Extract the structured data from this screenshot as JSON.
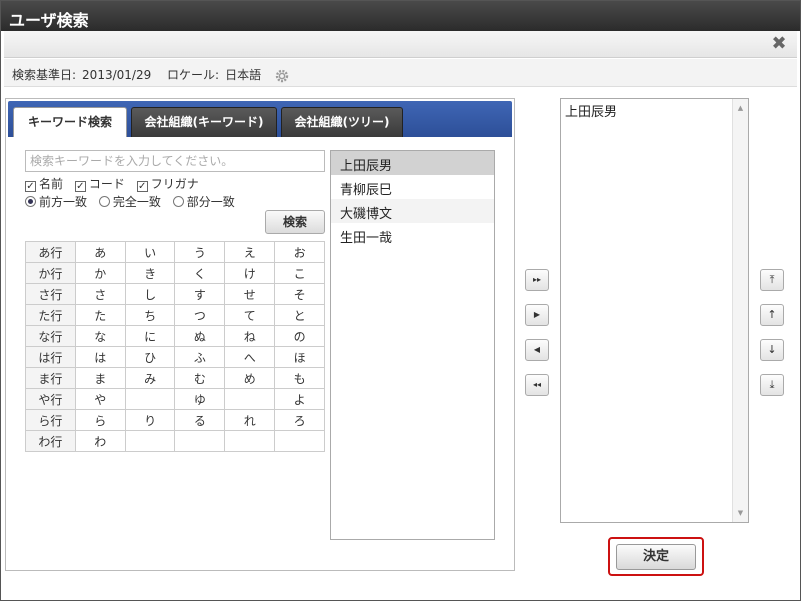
{
  "window": {
    "title": "ユーザ検索"
  },
  "toolbar": {
    "close_icon": "close-icon"
  },
  "info": {
    "base_date_label": "検索基準日:",
    "base_date_value": "2013/01/29",
    "locale_label": "ロケール:",
    "locale_value": "日本語",
    "settings_icon": "gear-icon"
  },
  "tabs": [
    {
      "label": "キーワード検索",
      "active": true
    },
    {
      "label": "会社組織(キーワード)",
      "active": false
    },
    {
      "label": "会社組織(ツリー)",
      "active": false
    }
  ],
  "search": {
    "placeholder": "検索キーワードを入力してください。",
    "value": "",
    "targets": [
      {
        "label": "名前",
        "checked": true
      },
      {
        "label": "コード",
        "checked": true
      },
      {
        "label": "フリガナ",
        "checked": true
      }
    ],
    "match_modes": [
      {
        "label": "前方一致",
        "selected": true
      },
      {
        "label": "完全一致",
        "selected": false
      },
      {
        "label": "部分一致",
        "selected": false
      }
    ],
    "search_button": "検索"
  },
  "kana_rows": [
    [
      "あ行",
      "あ",
      "い",
      "う",
      "え",
      "お"
    ],
    [
      "か行",
      "か",
      "き",
      "く",
      "け",
      "こ"
    ],
    [
      "さ行",
      "さ",
      "し",
      "す",
      "せ",
      "そ"
    ],
    [
      "た行",
      "た",
      "ち",
      "つ",
      "て",
      "と"
    ],
    [
      "な行",
      "な",
      "に",
      "ぬ",
      "ね",
      "の"
    ],
    [
      "は行",
      "は",
      "ひ",
      "ふ",
      "へ",
      "ほ"
    ],
    [
      "ま行",
      "ま",
      "み",
      "む",
      "め",
      "も"
    ],
    [
      "や行",
      "や",
      "",
      "ゆ",
      "",
      "よ"
    ],
    [
      "ら行",
      "ら",
      "り",
      "る",
      "れ",
      "ろ"
    ],
    [
      "わ行",
      "わ",
      "",
      "",
      "",
      ""
    ]
  ],
  "results": [
    {
      "name": "上田辰男",
      "selected": true
    },
    {
      "name": "青柳辰巳",
      "selected": false
    },
    {
      "name": "大磯博文",
      "selected": false
    },
    {
      "name": "生田一哉",
      "selected": false
    }
  ],
  "move_buttons": [
    {
      "glyph": "▸▸",
      "icon": "add-all-icon"
    },
    {
      "glyph": "▶",
      "icon": "add-icon"
    },
    {
      "glyph": "◀",
      "icon": "remove-icon"
    },
    {
      "glyph": "◂◂",
      "icon": "remove-all-icon"
    }
  ],
  "order_buttons": [
    {
      "glyph": "⤒",
      "icon": "move-top-icon"
    },
    {
      "glyph": "↑",
      "icon": "move-up-icon"
    },
    {
      "glyph": "↓",
      "icon": "move-down-icon"
    },
    {
      "glyph": "⤓",
      "icon": "move-bottom-icon"
    }
  ],
  "selected_users": [
    "上田辰男"
  ],
  "decide_button": "決定"
}
